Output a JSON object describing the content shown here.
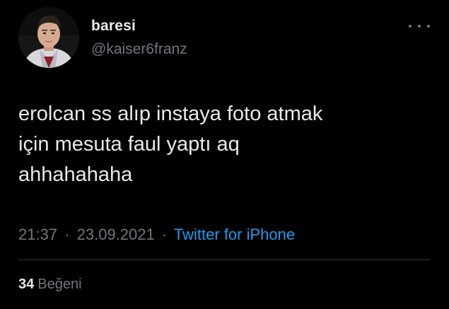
{
  "tweet": {
    "author": {
      "name": "baresi",
      "handle": "@kaiser6franz",
      "avatar_icon": "profile-photo"
    },
    "more_icon": "ellipsis-icon",
    "text_lines": [
      "erolcan ss alıp instaya foto atmak",
      "için mesuta faul yaptı aq",
      "ahhahahaha"
    ],
    "time": "21:37",
    "date": "23.09.2021",
    "separator": "·",
    "source": "Twitter for iPhone",
    "likes": {
      "count": "34",
      "label": "Beğeni"
    }
  },
  "colors": {
    "background": "#000000",
    "primary_text": "#e7e9ea",
    "secondary_text": "#71767b",
    "link": "#1d9bf0",
    "divider": "#2f3336"
  }
}
